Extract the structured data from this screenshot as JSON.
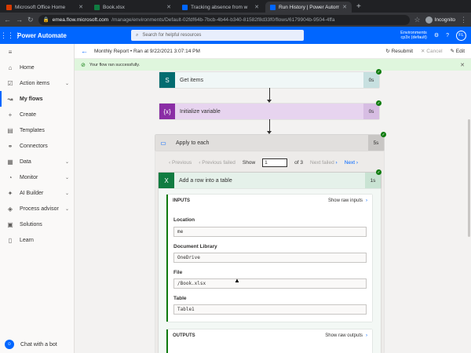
{
  "browser": {
    "tabs": [
      {
        "label": "Microsoft Office Home",
        "color": "#d83b01"
      },
      {
        "label": "Book.xlsx",
        "color": "#107c41"
      },
      {
        "label": "Tracking absence from w",
        "color": "#0066ff"
      },
      {
        "label": "Run History | Power Autom",
        "color": "#0066ff"
      }
    ],
    "url_host": "emea.flow.microsoft.com",
    "url_path": "/manage/environments/Default-02fdf64b-7bcb-4b44-b340-81582f8d33f0/flows/6179904b-9504-4ffa",
    "profile": "Incognito"
  },
  "app": {
    "brand": "Power Automate",
    "search_placeholder": "Search for helpful resources",
    "env_label": "Environments",
    "env_name": "cp3x (default)",
    "avatar": "FL"
  },
  "sidebar": {
    "items": [
      {
        "label": "Home",
        "icon": "⌂"
      },
      {
        "label": "Action items",
        "icon": "☑"
      },
      {
        "label": "My flows",
        "icon": "↝"
      },
      {
        "label": "Create",
        "icon": "+"
      },
      {
        "label": "Templates",
        "icon": "▤"
      },
      {
        "label": "Connectors",
        "icon": "⚭"
      },
      {
        "label": "Data",
        "icon": "▦"
      },
      {
        "label": "Monitor",
        "icon": "◔"
      },
      {
        "label": "AI Builder",
        "icon": "✦"
      },
      {
        "label": "Process advisor",
        "icon": "◈"
      },
      {
        "label": "Solutions",
        "icon": "▣"
      },
      {
        "label": "Learn",
        "icon": "▯"
      }
    ],
    "chat": "Chat with a bot"
  },
  "command": {
    "breadcrumb": "Monthly Report • Ran at 9/22/2021 3:07:14 PM",
    "resubmit": "Resubmit",
    "cancel": "Cancel",
    "edit": "Edit"
  },
  "banner": "Your flow ran successfully.",
  "steps": {
    "get_items": {
      "title": "Get items",
      "duration": "0s"
    },
    "init_var": {
      "title": "Initialize variable",
      "duration": "0s"
    },
    "apply": {
      "title": "Apply to each",
      "duration": "5s"
    }
  },
  "pager": {
    "previous": "Previous",
    "previous_failed": "Previous failed",
    "show": "Show",
    "page": "1",
    "of": "of 3",
    "next_failed": "Next failed",
    "next": "Next"
  },
  "add_row": {
    "title": "Add a row into a table",
    "duration": "1s",
    "inputs": "INPUTS",
    "show_raw_inputs": "Show raw inputs",
    "outputs": "OUTPUTS",
    "show_raw_outputs": "Show raw outputs",
    "fields": [
      {
        "label": "Location",
        "value": "me"
      },
      {
        "label": "Document Library",
        "value": "OneDrive"
      },
      {
        "label": "File",
        "value": "/Book.xlsx"
      },
      {
        "label": "Table",
        "value": "Table1"
      }
    ]
  },
  "colors": {
    "accent": "#0066ff",
    "sharepoint": "#036c70",
    "variable": "#8a2da5",
    "excel": "#107c41",
    "success": "#107c10"
  }
}
